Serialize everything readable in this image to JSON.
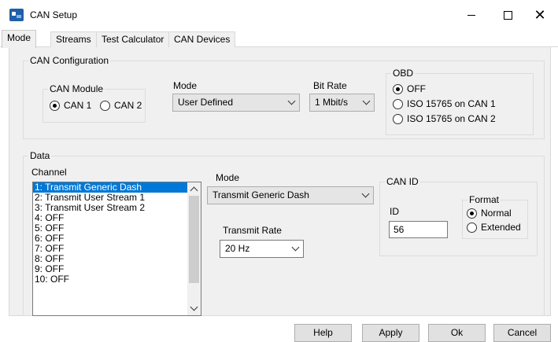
{
  "window": {
    "title": "CAN Setup"
  },
  "tabs": [
    "Mode",
    "Streams",
    "Test Calculator",
    "CAN Devices"
  ],
  "can_config": {
    "title": "CAN Configuration",
    "module": {
      "title": "CAN Module",
      "options": [
        "CAN 1",
        "CAN 2"
      ],
      "selected": 0
    },
    "mode": {
      "label": "Mode",
      "value": "User Defined"
    },
    "bit_rate": {
      "label": "Bit Rate",
      "value": "1 Mbit/s"
    },
    "obd": {
      "title": "OBD",
      "options": [
        "OFF",
        "ISO 15765 on CAN 1",
        "ISO 15765 on CAN 2"
      ],
      "selected": 0
    }
  },
  "data": {
    "title": "Data",
    "channel_label": "Channel",
    "channels": [
      "1: Transmit Generic Dash",
      "2: Transmit User Stream 1",
      "3: Transmit User Stream 2",
      "4: OFF",
      "5: OFF",
      "6: OFF",
      "7: OFF",
      "8: OFF",
      "9: OFF",
      "10: OFF"
    ],
    "selected_channel": 0,
    "mode": {
      "label": "Mode",
      "value": "Transmit Generic Dash"
    },
    "transmit_rate": {
      "label": "Transmit Rate",
      "value": "20 Hz"
    },
    "can_id": {
      "title": "CAN ID",
      "id_label": "ID",
      "id_value": "56",
      "format": {
        "title": "Format",
        "options": [
          "Normal",
          "Extended"
        ],
        "selected": 0
      }
    }
  },
  "buttons": {
    "help": "Help",
    "apply": "Apply",
    "ok": "Ok",
    "cancel": "Cancel"
  }
}
